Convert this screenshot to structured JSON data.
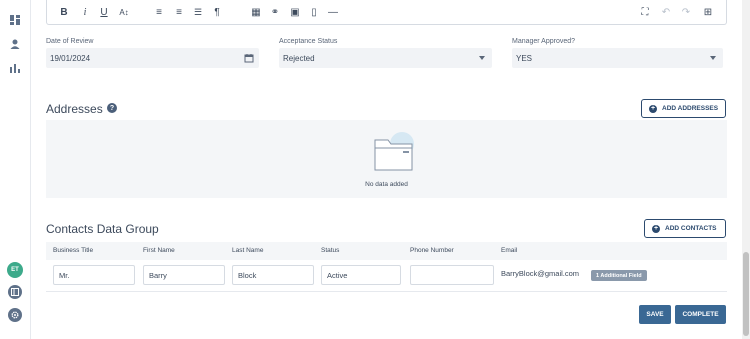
{
  "editor_toolbar": {
    "items": [
      {
        "name": "bold",
        "glyph": "B"
      },
      {
        "name": "italic",
        "glyph": "i"
      },
      {
        "name": "underline",
        "glyph": "U"
      },
      {
        "name": "text-size",
        "glyph": "A↕"
      },
      {
        "name": "align-left",
        "glyph": "≡"
      },
      {
        "name": "align-center",
        "glyph": "≡"
      },
      {
        "name": "list",
        "glyph": "☰"
      },
      {
        "name": "paragraph",
        "glyph": "¶"
      },
      {
        "name": "table",
        "glyph": "▦"
      },
      {
        "name": "link",
        "glyph": "⚭"
      },
      {
        "name": "image",
        "glyph": "▣"
      },
      {
        "name": "file",
        "glyph": "▯"
      },
      {
        "name": "horizontal-rule",
        "glyph": "—"
      },
      {
        "name": "fullscreen",
        "glyph": "⛶"
      },
      {
        "name": "undo",
        "glyph": "↶"
      },
      {
        "name": "redo",
        "glyph": "↷"
      },
      {
        "name": "code-view",
        "glyph": "⊞"
      }
    ]
  },
  "fields": {
    "date_of_review": {
      "label": "Date of Review",
      "value": "19/01/2024"
    },
    "acceptance_status": {
      "label": "Acceptance Status",
      "value": "Rejected"
    },
    "manager_approved": {
      "label": "Manager Approved?",
      "value": "YES"
    }
  },
  "addresses": {
    "title": "Addresses",
    "help": "?",
    "add_button": "ADD ADDRESSES",
    "empty_text": "No data added"
  },
  "contacts": {
    "title": "Contacts Data Group",
    "add_button": "ADD CONTACTS",
    "columns": [
      "Business Title",
      "First Name",
      "Last Name",
      "Status",
      "Phone Number",
      "Email"
    ],
    "row": {
      "business_title": "Mr.",
      "first_name": "Barry",
      "last_name": "Block",
      "status": "Active",
      "phone_number": "",
      "email": "BarryBlock@gmail.com",
      "additional": "1 Additional Field"
    }
  },
  "actions": {
    "save": "SAVE",
    "complete": "COMPLETE"
  },
  "user": {
    "initials": "ET"
  },
  "colors": {
    "primary": "#3a6894",
    "outline": "#2c4a6e",
    "avatar": "#3daa8b"
  }
}
